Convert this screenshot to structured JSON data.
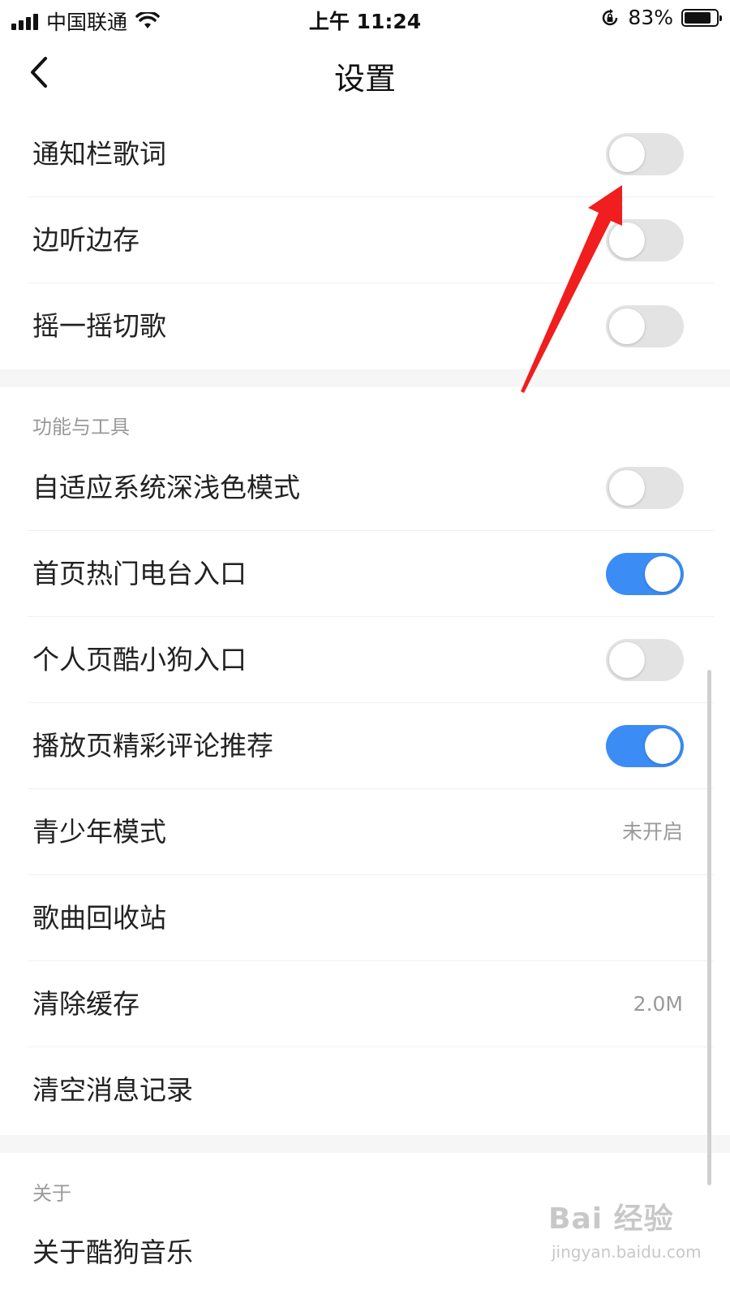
{
  "status_bar": {
    "carrier": "中国联通",
    "time": "上午 11:24",
    "battery": "83%",
    "battery_level": 0.83
  },
  "nav": {
    "title": "设置",
    "back_icon": "chevron-left-icon"
  },
  "rows_top": [
    {
      "label": "通知栏歌词",
      "toggle": false
    },
    {
      "label": "边听边存",
      "toggle": false
    },
    {
      "label": "摇一摇切歌",
      "toggle": false
    }
  ],
  "section_tools": {
    "header": "功能与工具",
    "items": [
      {
        "label": "自适应系统深浅色模式",
        "toggle": false
      },
      {
        "label": "首页热门电台入口",
        "toggle": true
      },
      {
        "label": "个人页酷小狗入口",
        "toggle": false
      },
      {
        "label": "播放页精彩评论推荐",
        "toggle": true
      },
      {
        "label": "青少年模式",
        "value": "未开启"
      },
      {
        "label": "歌曲回收站"
      },
      {
        "label": "清除缓存",
        "value": "2.0M"
      },
      {
        "label": "清空消息记录"
      }
    ]
  },
  "section_about": {
    "header": "关于",
    "items": [
      {
        "label": "关于酷狗音乐"
      }
    ]
  },
  "watermark": {
    "title": "Bai 经验",
    "url": "jingyan.baidu.com"
  },
  "colors": {
    "toggle_on": "#3b8cf5",
    "toggle_off": "#e3e3e3",
    "annotation_arrow": "#f01e1e"
  }
}
